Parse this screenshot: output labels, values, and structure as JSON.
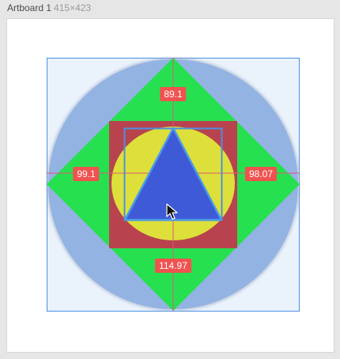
{
  "window": {
    "artboard_name": "Artboard 1",
    "artboard_size": "415×423"
  },
  "measurements": {
    "top": "89.1",
    "left": "99.1",
    "right": "98.07",
    "bottom": "114.97"
  },
  "colors": {
    "background": "#e6e6e6",
    "artboard": "#ffffff",
    "selection": "#4a90e2",
    "guide": "#e0567a",
    "circle": "#93b3e3",
    "diamond": "#27e050",
    "square": "#b8434e",
    "ellipse": "#dde03a",
    "triangle": "#3f5ad6",
    "label_bg": "#f0524f"
  },
  "icons": {
    "cursor": "arrow-cursor-icon"
  }
}
